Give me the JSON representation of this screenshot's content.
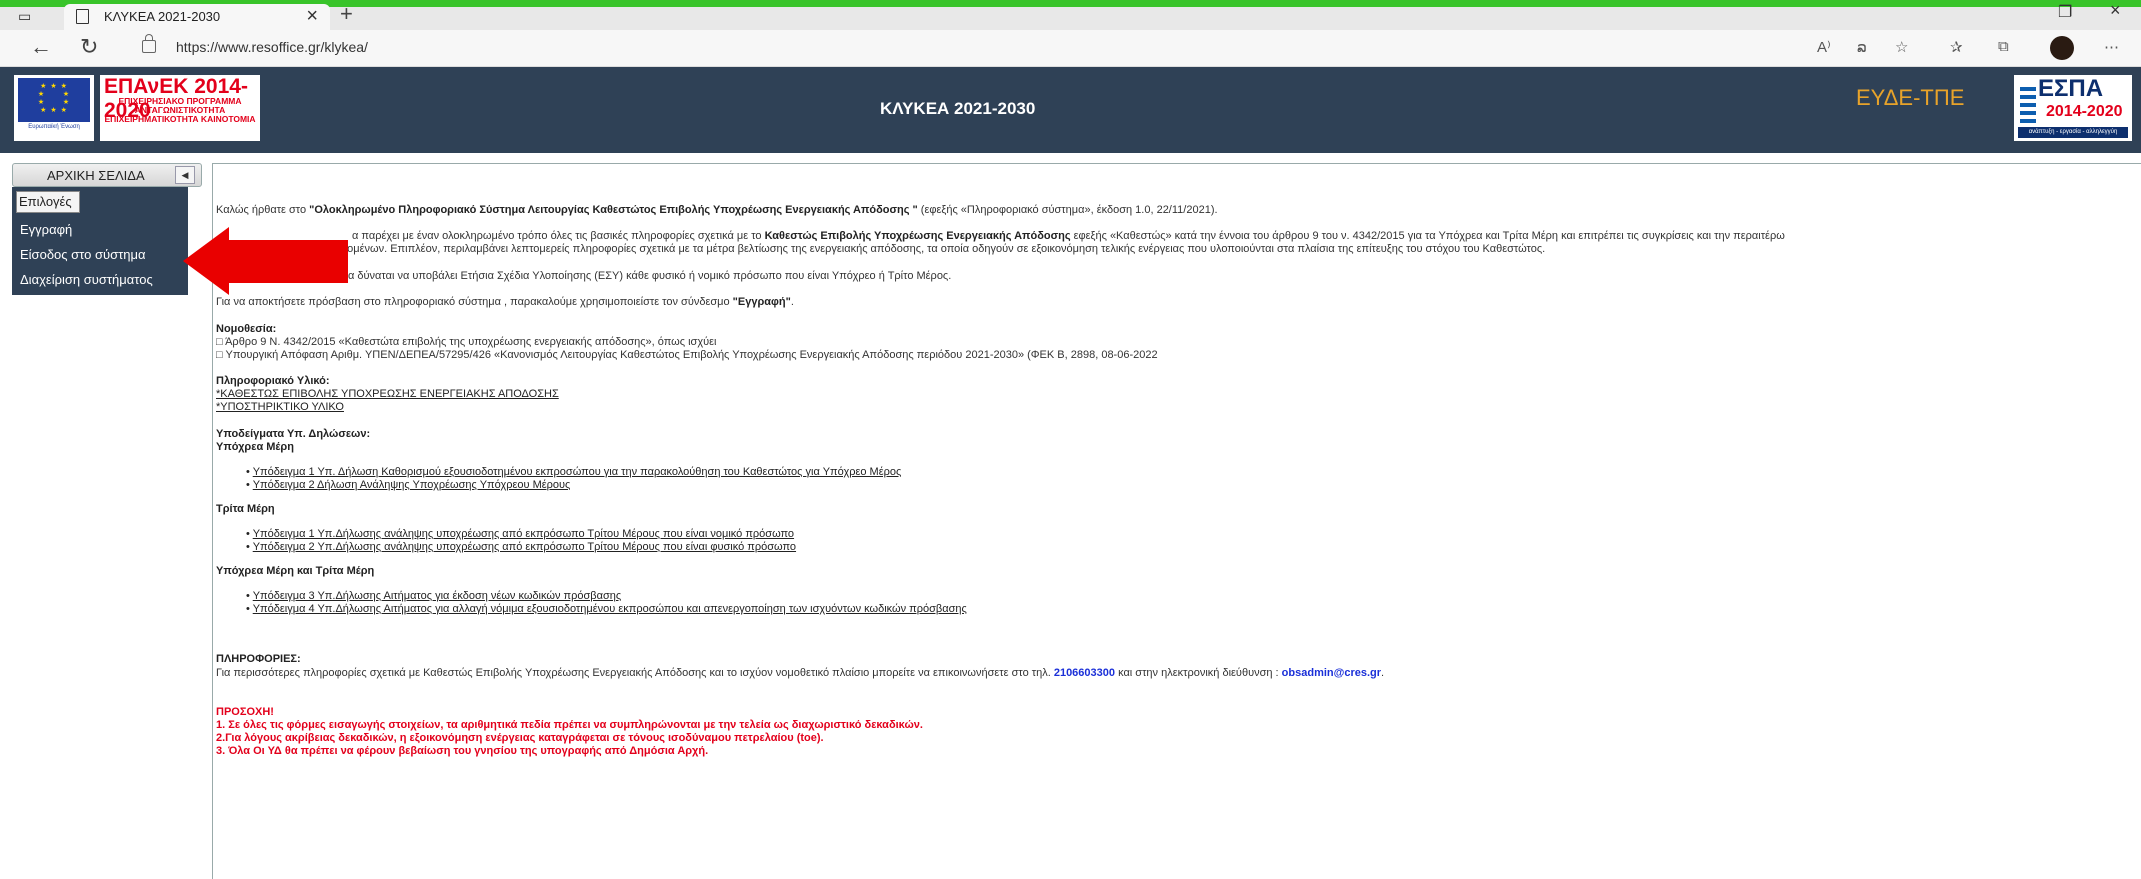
{
  "browser": {
    "tab_title": "ΚΛΥΚΕΑ 2021-2030",
    "url": "https://www.resoffice.gr/klykea/"
  },
  "header": {
    "title": "ΚΛΥΚΕΑ 2021-2030",
    "eu_logo_text": "Ευρωπαϊκή Ένωση",
    "epanek_logo": {
      "title": "ΕΠΑνΕΚ 2014-2020",
      "subtitle": "ΕΠΙΧΕΙΡΗΣΙΑΚΟ ΠΡΟΓΡΑΜΜΑ ΑΝΤΑΓΩΝΙΣΤΙΚΟΤΗΤΑ ΕΠΙΧΕΙΡΗΜΑΤΙΚΟΤΗΤΑ ΚΑΙΝΟΤΟΜΙΑ"
    },
    "eyde_logo": "ΕΥΔΕ-ΤΠΕ",
    "espa_logo": {
      "title": "ΕΣΠΑ",
      "years": "2014-2020",
      "motto": "ανάπτυξη - εργασία - αλληλεγγύη"
    }
  },
  "sidebar": {
    "header": "ΑΡΧΙΚΗ ΣΕΛΙΔΑ",
    "items": [
      {
        "label": "Επιλογές"
      },
      {
        "label": "Εγγραφή"
      },
      {
        "label": "Είσοδος στο σύστημα"
      },
      {
        "label": "Διαχείριση συστήματος"
      }
    ]
  },
  "content": {
    "welcome_pre": "Καλώς ήρθατε στο ",
    "welcome_bold": "\"Ολοκληρωμένο Πληροφοριακό Σύστημα Λειτουργίας Καθεστώτος Επιβολής Υποχρέωσης Ενεργειακής Απόδοσης \"",
    "welcome_post": " (εφεξής «Πληροφοριακό σύστημα», έκδοση 1.0, 22/11/2021).",
    "para2_line1_a": "α παρέχει με έναν ολοκληρωμένο τρόπο όλες τις βασικές πληροφορίες σχετικά με το ",
    "para2_line1_bold": "Καθεστώς Επιβολής Υποχρέωσης Ενεργειακής Απόδοσης",
    "para2_line1_b": " εφεξής «Καθεστώς» κατά την έννοια του άρθρου 9 του ν. 4342/2015 για τα Υπόχρεα και Τρίτα Μέρη και επιτρέπει τις συγκρίσεις και την περαιτέρω",
    "para2_line2": "δεδομένων. Επιπλέον, περιλαμβάνει λεπτομερείς πληροφορίες σχετικά με τα μέτρα βελτίωσης της ενεργειακής απόδοσης, τα οποία οδηγούν σε εξοικονόμηση τελικής ενέργειας που υλοποιούνται στα πλαίσια της επίτευξης του στόχου του Καθεστώτος.",
    "para3": "ο πληροφοριακό σύστημα δύναται να υποβάλει Ετήσια Σχέδια Υλοποίησης (ΕΣΥ) κάθε φυσικό ή νομικό πρόσωπο που είναι Υπόχρεο ή Τρίτο Μέρος.",
    "para4_pre": "Για να αποκτήσετε πρόσβαση στο πληροφοριακό σύστημα , παρακαλούμε χρησιμοποιείστε τον σύνδεσμο ",
    "para4_bold": "\"Εγγραφή\"",
    "para4_post": ".",
    "law_heading": "Νομοθεσία:",
    "law1": "□ Άρθρο 9 Ν. 4342/2015 «Καθεστώτα επιβολής της υποχρέωσης ενεργειακής απόδοσης», όπως ισχύει",
    "law2": "□ Υπουργική Απόφαση Αριθμ. ΥΠΕΝ/ΔΕΠΕΑ/57295/426 «Κανονισμός Λειτουργίας Καθεστώτος Επιβολής Υποχρέωσης Ενεργειακής Απόδοσης περιόδου 2021-2030» (ΦΕΚ Β, 2898, 08-06-2022",
    "info_heading": "Πληροφοριακό Υλικό:",
    "info_link1": "*ΚΑΘΕΣΤΩΣ ΕΠΙΒΟΛΗΣ ΥΠΟΧΡΕΩΣΗΣ ΕΝΕΡΓΕΙΑΚΗΣ ΑΠΟΔΟΣΗΣ",
    "info_link2": "*ΥΠΟΣΤΗΡΙΚΤΙΚΟ ΥΛΙΚΟ",
    "templates_heading": "Υποδείγματα Υπ. Δηλώσεων:",
    "obliged_heading": "Υπόχρεα Μέρη",
    "obliged_items": [
      "Υπόδειγμα 1 Υπ. Δήλωση Καθορισμού εξουσιοδοτημένου εκπροσώπου για την παρακολούθηση του Καθεστώτος για Υπόχρεο Μέρος",
      "Υπόδειγμα 2 Δήλωση Ανάληψης Υποχρέωσης Υπόχρεου Μέρους"
    ],
    "third_heading": "Τρίτα Μέρη",
    "third_items": [
      "Υπόδειγμα 1 Υπ.Δήλωσης ανάληψης υποχρέωσης από εκπρόσωπο Τρίτου Μέρους που είναι νομικό πρόσωπο",
      "Υπόδειγμα 2 Υπ.Δήλωσης ανάληψης υποχρέωσης από εκπρόσωπο Τρίτου Μέρους που είναι φυσικό πρόσωπο"
    ],
    "both_heading": "Υπόχρεα Μέρη και Τρίτα Μέρη",
    "both_items": [
      "Υπόδειγμα 3 Υπ.Δήλωσης Αιτήματος για έκδοση νέων κωδικών πρόσβασης",
      "Υπόδειγμα 4 Υπ.Δήλωσης Αιτήματος για αλλαγή νόμιμα εξουσιοδοτημένου εκπροσώπου και απενεργοποίηση των ισχυόντων κωδικών πρόσβασης"
    ],
    "contact_heading": "ΠΛΗΡΟΦΟΡΙΕΣ:",
    "contact_pre": "Για περισσότερες πληροφορίες σχετικά με Καθεστώς Επιβολής Υποχρέωσης Ενεργειακής Απόδοσης και το ισχύον νομοθετικό πλαίσιο μπορείτε να επικοινωνήσετε στο τηλ. ",
    "contact_phone": "2106603300",
    "contact_mid": " και στην ηλεκτρονική διεύθυνση : ",
    "contact_email": "obsadmin@cres.gr",
    "contact_post": ".",
    "warning_heading": "ΠΡΟΣΟΧΗ!",
    "warnings": [
      "1. Σε όλες τις φόρμες εισαγωγής στοιχείων, τα αριθμητικά πεδία πρέπει να συμπληρώνονται με την τελεία ως διαχωριστικό δεκαδικών.",
      "2.Για λόγους ακρίβειας δεκαδικών, η εξοικονόμηση ενέργειας καταγράφεται σε τόνους ισοδύναμου πετρελαίου (toe).",
      "3. Όλα Οι ΥΔ θα πρέπει να φέρουν βεβαίωση του γνησίου της υπογραφής από Δημόσια Αρχή."
    ]
  }
}
